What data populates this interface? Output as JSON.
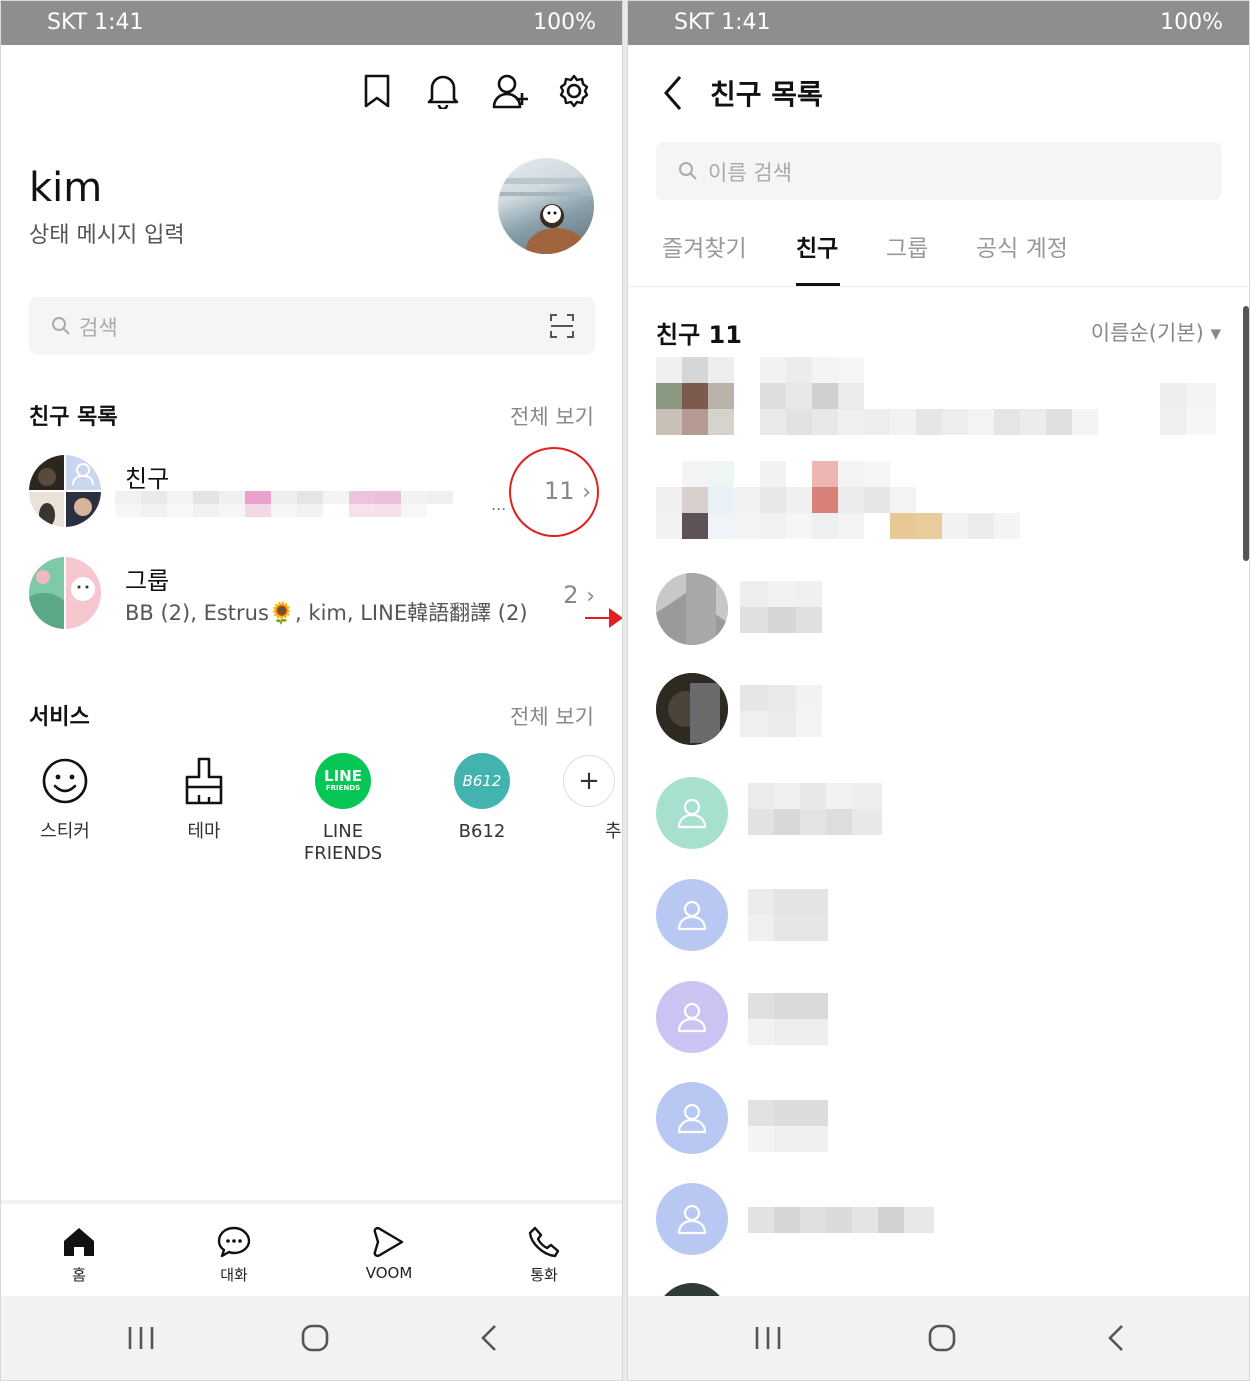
{
  "left": {
    "status_bar": {
      "carrier_time": "SKT 1:41",
      "battery": "100%"
    },
    "top_icons": [
      "bookmark-icon",
      "bell-icon",
      "add-friend-icon",
      "gear-icon"
    ],
    "profile": {
      "name": "kim",
      "status_message": "상태 메시지 입력"
    },
    "search": {
      "placeholder": "검색"
    },
    "friends_section": {
      "title": "친구 목록",
      "see_all": "전체 보기",
      "friends_row": {
        "title": "친구",
        "count": "11",
        "ellipsis": "..."
      },
      "groups_row": {
        "title": "그룹",
        "members": "BB (2), Estrus🌻, kim, LINE韓語翻譯 (2)",
        "count": "2"
      }
    },
    "services_section": {
      "title": "서비스",
      "see_all": "전체 보기",
      "items": [
        {
          "label": "스티커",
          "icon": "smiley-icon"
        },
        {
          "label": "테마",
          "icon": "brush-icon"
        },
        {
          "label": "LINE\nFRIENDS",
          "icon": "line-friends-logo",
          "logo_text": "LINE",
          "logo_sub": "FRIENDS",
          "color": "#06c755"
        },
        {
          "label": "B612",
          "icon": "b612-logo",
          "logo_text": "B612",
          "color": "#43b3b0"
        },
        {
          "label": "추",
          "icon": "plus-icon"
        }
      ]
    },
    "bottom_tabs": [
      {
        "label": "홈",
        "icon": "home-icon",
        "active": true
      },
      {
        "label": "대화",
        "icon": "chat-icon"
      },
      {
        "label": "VOOM",
        "icon": "voom-icon"
      },
      {
        "label": "통화",
        "icon": "phone-icon"
      }
    ],
    "accent_colors": {
      "annotation": "#e02020"
    }
  },
  "right": {
    "status_bar": {
      "carrier_time": "SKT 1:41",
      "battery": "100%"
    },
    "header": {
      "title": "친구 목록"
    },
    "search": {
      "placeholder": "이름 검색"
    },
    "tabs": [
      {
        "label": "즐겨찾기",
        "active": false
      },
      {
        "label": "친구",
        "active": true
      },
      {
        "label": "그룹",
        "active": false
      },
      {
        "label": "공식 계정",
        "active": false
      }
    ],
    "list_header": {
      "count_label": "친구 11",
      "sort_label": "이름순(기본) ▾"
    },
    "default_avatar_colors": [
      "#a8e0cf",
      "#b8c8f2",
      "#c9c4f2",
      "#b8c8f2",
      "#b8c8f2"
    ]
  }
}
